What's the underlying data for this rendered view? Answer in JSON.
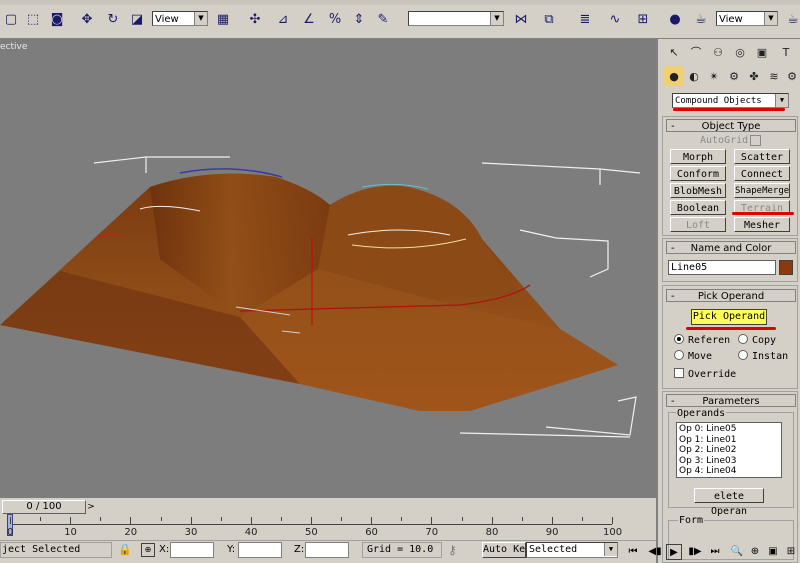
{
  "toolbar": {
    "view_dropdown": "View",
    "view_dropdown_right": "View",
    "named_selection": "",
    "icons": [
      "select-region-icon",
      "window-crossing-icon",
      "move-icon",
      "rotate-icon",
      "snap-icon",
      "angle-snap-icon",
      "percent-snap-icon",
      "mirror-icon",
      "align-icon",
      "material-editor-icon",
      "render-scene-icon",
      "quick-render-icon"
    ]
  },
  "viewport": {
    "label": "ective",
    "model_color": "#8b4513"
  },
  "command_panel": {
    "category_dropdown": "Compound Objects",
    "object_type": {
      "header": "Object Type",
      "autogrid_label": "AutoGrid",
      "buttons": [
        "Morph",
        "Scatter",
        "Conform",
        "Connect",
        "BlobMesh",
        "ShapeMerge",
        "Boolean",
        "Terrain",
        "Loft",
        "Mesher"
      ]
    },
    "name_color": {
      "header": "Name and Color",
      "name_value": "Line05",
      "swatch_color": "#8b3a0f"
    },
    "pick_operand": {
      "header": "Pick Operand",
      "button_label": "Pick Operand",
      "options": [
        "Referen",
        "Copy",
        "Move",
        "Instan"
      ],
      "override_label": "Override"
    },
    "parameters": {
      "header": "Parameters",
      "operands_label": "Operands",
      "operands": [
        "Op 0: Line05",
        "Op 1: Line01",
        "Op 2: Line02",
        "Op 3: Line03",
        "Op 4: Line04"
      ],
      "delete_button": "elete Operan",
      "form_label": "Form"
    }
  },
  "timeline": {
    "frame_counter": "0 / 100",
    "ticks": [
      "0",
      "10",
      "20",
      "30",
      "40",
      "50",
      "60",
      "70",
      "80",
      "90",
      "100"
    ]
  },
  "status_bar": {
    "selection_text": "ject Selected",
    "x_label": "X:",
    "y_label": "Y:",
    "z_label": "Z:",
    "grid_text": "Grid = 10.0",
    "auto_key": "Auto Key",
    "selected_dropdown": "Selected"
  }
}
